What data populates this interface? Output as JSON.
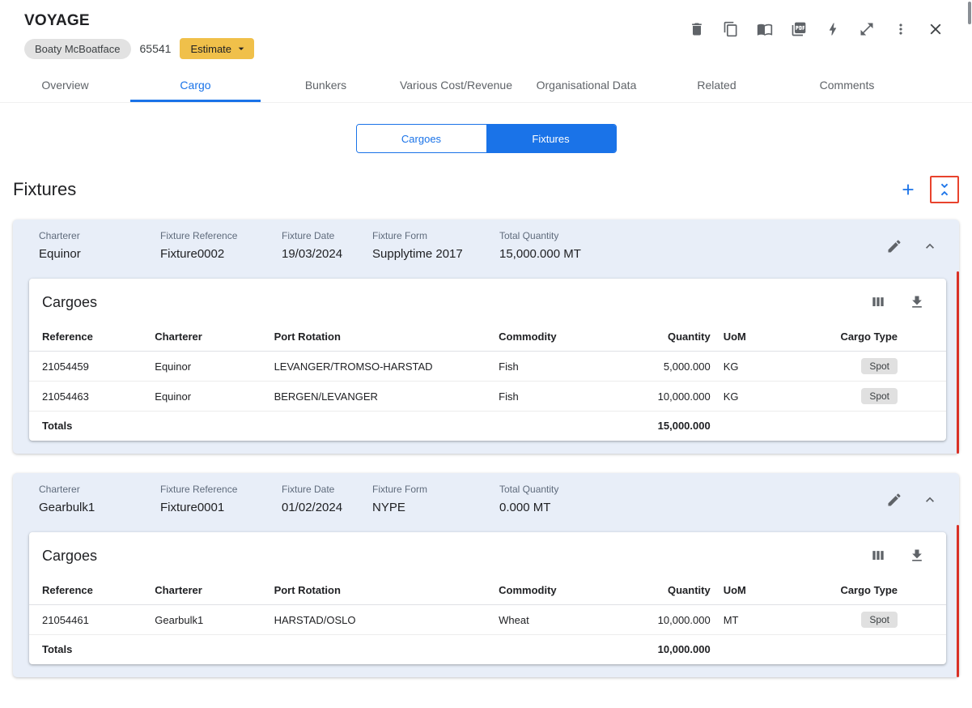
{
  "colors": {
    "accent_blue": "#1a73e8",
    "estimate_amber": "#F0C04A",
    "fixture_header_bg": "#E8EEF8",
    "alert_red": "#D93025",
    "chip_gray": "#E0E0E0"
  },
  "header": {
    "title": "VOYAGE",
    "vessel_name": "Boaty McBoatface",
    "voyage_number": "65541",
    "estimate_label": "Estimate",
    "icons": [
      "delete-icon",
      "copy-icon",
      "book-icon",
      "pdf-icon",
      "bolt-icon",
      "expand-icon",
      "more-icon",
      "close-icon"
    ]
  },
  "tabs": [
    {
      "label": "Overview",
      "active": false
    },
    {
      "label": "Cargo",
      "active": true
    },
    {
      "label": "Bunkers",
      "active": false
    },
    {
      "label": "Various Cost/Revenue",
      "active": false
    },
    {
      "label": "Organisational Data",
      "active": false
    },
    {
      "label": "Related",
      "active": false
    },
    {
      "label": "Comments",
      "active": false
    }
  ],
  "view_toggle": {
    "options": [
      {
        "label": "Cargoes",
        "active": false
      },
      {
        "label": "Fixtures",
        "active": true
      }
    ]
  },
  "section": {
    "title": "Fixtures"
  },
  "fixtures": [
    {
      "fields": [
        {
          "label": "Charterer",
          "value": "Equinor"
        },
        {
          "label": "Fixture Reference",
          "value": "Fixture0002"
        },
        {
          "label": "Fixture Date",
          "value": "19/03/2024"
        },
        {
          "label": "Fixture Form",
          "value": "Supplytime 2017"
        },
        {
          "label": "Total Quantity",
          "value": "15,000.000 MT"
        }
      ],
      "cargoes": {
        "title": "Cargoes",
        "columns": [
          "Reference",
          "Charterer",
          "Port Rotation",
          "Commodity",
          "Quantity",
          "UoM",
          "Cargo Type"
        ],
        "rows": [
          [
            "21054459",
            "Equinor",
            "LEVANGER/TROMSO-HARSTAD",
            "Fish",
            "5,000.000",
            "KG",
            "Spot"
          ],
          [
            "21054463",
            "Equinor",
            "BERGEN/LEVANGER",
            "Fish",
            "10,000.000",
            "KG",
            "Spot"
          ]
        ],
        "totals_label": "Totals",
        "total_quantity": "15,000.000"
      }
    },
    {
      "fields": [
        {
          "label": "Charterer",
          "value": "Gearbulk1"
        },
        {
          "label": "Fixture Reference",
          "value": "Fixture0001"
        },
        {
          "label": "Fixture Date",
          "value": "01/02/2024"
        },
        {
          "label": "Fixture Form",
          "value": "NYPE"
        },
        {
          "label": "Total Quantity",
          "value": "0.000 MT"
        }
      ],
      "cargoes": {
        "title": "Cargoes",
        "columns": [
          "Reference",
          "Charterer",
          "Port Rotation",
          "Commodity",
          "Quantity",
          "UoM",
          "Cargo Type"
        ],
        "rows": [
          [
            "21054461",
            "Gearbulk1",
            "HARSTAD/OSLO",
            "Wheat",
            "10,000.000",
            "MT",
            "Spot"
          ]
        ],
        "totals_label": "Totals",
        "total_quantity": "10,000.000"
      }
    }
  ]
}
